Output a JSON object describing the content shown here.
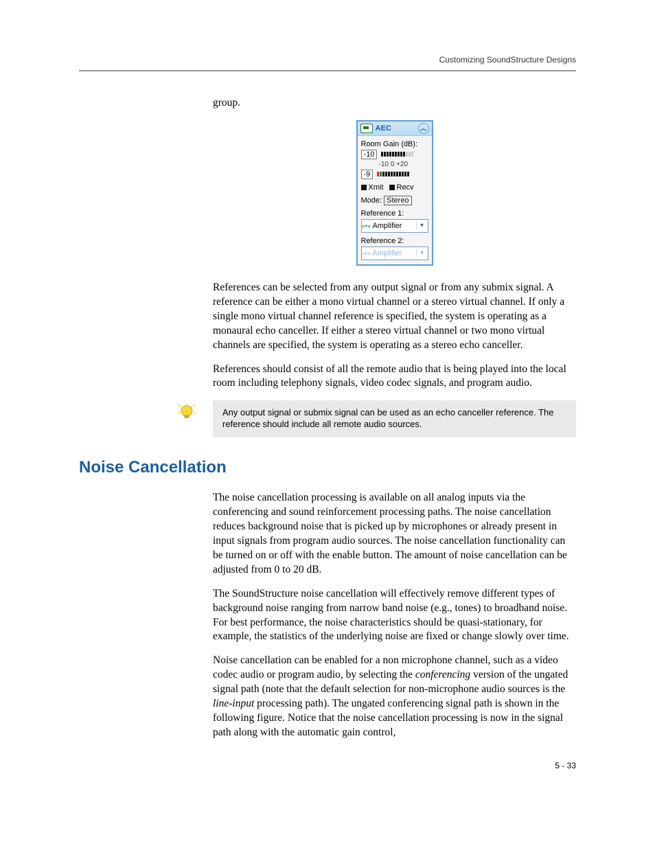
{
  "header": {
    "running_title": "Customizing SoundStructure Designs"
  },
  "intro_tail": "group.",
  "aec_panel": {
    "title": "AEC",
    "room_gain_label": "Room Gain (dB):",
    "value1": "-10",
    "scale": "-10  0     +20",
    "value2": "-9",
    "xmit": "Xmit",
    "recv": "Recv",
    "mode_label": "Mode:",
    "mode_value": "Stereo",
    "ref1_label": "Reference 1:",
    "ref1_value": "Amplifier",
    "ref2_label": "Reference 2:",
    "ref2_value": "Amplifier"
  },
  "para_refs": "References can be selected from any output signal or from any submix signal. A reference can be either a mono virtual channel or a stereo virtual channel.  If only a single mono virtual channel reference is specified, the system is operating as a monaural echo canceller.  If either a stereo virtual channel or two mono virtual channels are specified, the system is operating as a stereo echo canceller.",
  "para_refs2": "References should consist of all the remote audio that is being played into the local room including telephony signals, video codec signals, and program audio.",
  "note_text": "Any output signal or submix signal can be used as an echo canceller reference. The reference should include all remote audio sources.",
  "section_heading": "Noise Cancellation",
  "nc_para1": "The noise cancellation processing is available on all analog inputs via the conferencing and sound reinforcement processing paths. The noise cancellation reduces background noise that is picked up by microphones or already present in input signals from program audio sources. The noise cancellation functionality can be turned on or off with the enable button. The amount of noise cancellation can be adjusted from 0 to 20 dB.",
  "nc_para2": "The SoundStructure noise cancellation will effectively remove different types of background noise ranging from narrow band noise (e.g., tones) to broadband noise. For best performance, the noise characteristics should be quasi-stationary, for example, the statistics of the underlying noise are fixed or change slowly over time.",
  "nc_para3_a": "Noise cancellation can be enabled for a non microphone channel, such as a video codec audio or program audio, by selecting the ",
  "nc_para3_em1": "conferencing",
  "nc_para3_b": " version of the ungated signal path (note that the default selection for non-microphone audio sources is the ",
  "nc_para3_em2": "line-input",
  "nc_para3_c": " processing path). The ungated conferencing signal path is shown in the following figure. Notice that the noise cancellation processing is now in the signal path along with the automatic gain control,",
  "page_number": "5 - 33"
}
